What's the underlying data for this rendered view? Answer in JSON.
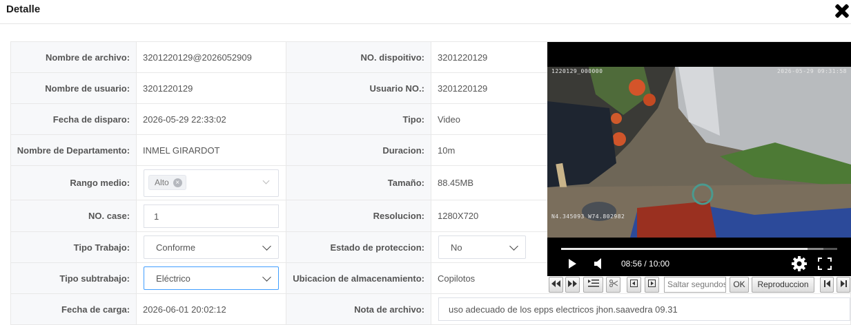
{
  "dialog": {
    "title": "Detalle"
  },
  "left_rows": [
    {
      "label": "Nombre de archivo:",
      "value": "3201220129@2026052909"
    },
    {
      "label": "Nombre de usuario:",
      "value": "3201220129"
    },
    {
      "label": "Fecha de disparo:",
      "value": "2026-05-29 22:33:02"
    },
    {
      "label": "Nombre de Departamento:",
      "value": "INMEL GIRARDOT"
    },
    {
      "label": "Rango medio:",
      "tag": "Alto"
    },
    {
      "label": "NO. case:",
      "value": "1"
    },
    {
      "label": "Tipo Trabajo:",
      "value": "Conforme"
    },
    {
      "label": "Tipo subtrabajo:",
      "value": "Eléctrico"
    },
    {
      "label": "Fecha de carga:",
      "value": "2026-06-01 20:02:12"
    }
  ],
  "right_rows": [
    {
      "label": "NO. dispoitivo:",
      "value": "3201220129"
    },
    {
      "label": "Usuario NO.:",
      "value": "3201220129"
    },
    {
      "label": "Tipo:",
      "value": "Video"
    },
    {
      "label": "Duracion:",
      "value": "10m"
    },
    {
      "label": "Tamaño:",
      "value": "88.45MB"
    },
    {
      "label": "Resolucion:",
      "value": "1280X720"
    },
    {
      "label": "Estado de proteccion:",
      "value": "No"
    },
    {
      "label": "Ubicacion de almacenamiento:",
      "value": "Copilotos"
    },
    {
      "label": "Nota de archivo:",
      "value": "uso adecuado de los epps electricos jhon.saavedra 09.31"
    }
  ],
  "video": {
    "osd_top_left": "1220129_000000",
    "osd_top_right": "2026-05-29 09:31:58",
    "osd_gps": "N4.345093 W74.802982",
    "time": "08:56 / 10:00",
    "progress": 0.893,
    "buffered": 0.95
  },
  "toolbar": {
    "seek_placeholder": "Saltar segundos",
    "ok_label": "OK",
    "speed_label": "Reproduccion",
    "icons": [
      "rewind-icon",
      "fast-forward-icon",
      "playlist-icon",
      "scissors-icon",
      "prev-frame-icon",
      "next-frame-icon",
      "skip-start-icon",
      "skip-end-icon"
    ]
  }
}
